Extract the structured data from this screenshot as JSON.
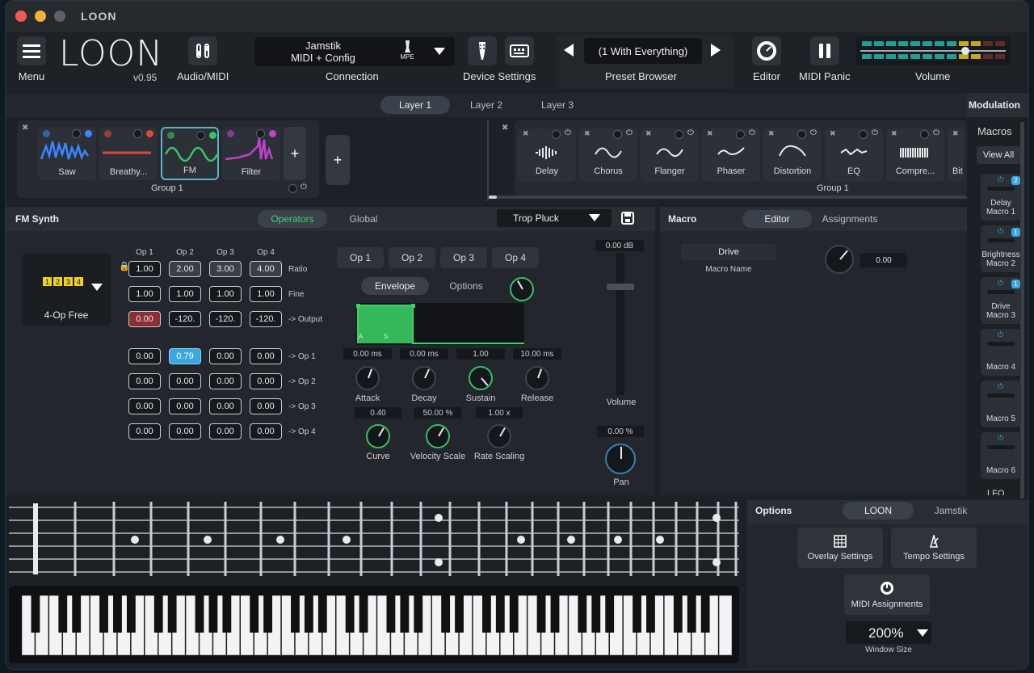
{
  "app": {
    "title": "LOON",
    "logo": "LOON",
    "version": "v0.95"
  },
  "toolbar": {
    "menu_label": "Menu",
    "audio_midi_label": "Audio/MIDI",
    "connection": {
      "line1": "Jamstik",
      "line2": "MIDI + Config",
      "badge": "MPE",
      "label": "Connection"
    },
    "device_settings_label": "Device Settings",
    "preset": {
      "name": "(1 With Everything)",
      "label": "Preset Browser"
    },
    "editor_label": "Editor",
    "midi_panic_label": "MIDI Panic",
    "volume_label": "Volume"
  },
  "layers": {
    "tabs": [
      "Layer 1",
      "Layer 2",
      "Layer 3"
    ],
    "active": 0
  },
  "instrument_group": {
    "name": "Group 1",
    "tiles": [
      {
        "name": "Saw",
        "color": "#3a86ff"
      },
      {
        "name": "Breathy...",
        "color": "#e0463a"
      },
      {
        "name": "FM",
        "color": "#39c46a"
      },
      {
        "name": "Filter",
        "color": "#c040d0"
      }
    ],
    "add_label": "+"
  },
  "add_group_label": "+",
  "fx_group": {
    "name": "Group 1",
    "items": [
      "Delay",
      "Chorus",
      "Flanger",
      "Phaser",
      "Distortion",
      "EQ",
      "Compre...",
      "Bit"
    ]
  },
  "fm_synth": {
    "title": "FM Synth",
    "tabs": [
      "Operators",
      "Global"
    ],
    "preset": "Trop Pluck",
    "algorithm": {
      "label": "4-Op Free",
      "ops": [
        "1",
        "2",
        "3",
        "4"
      ]
    },
    "columns": [
      "Op 1",
      "Op 2",
      "Op 3",
      "Op 4"
    ],
    "rows": [
      {
        "label": "Ratio",
        "values": [
          "1.00",
          "2.00",
          "3.00",
          "4.00"
        ]
      },
      {
        "label": "Fine",
        "values": [
          "1.00",
          "1.00",
          "1.00",
          "1.00"
        ]
      },
      {
        "label": "-> Output",
        "values": [
          "0.00",
          "-120.",
          "-120.",
          "-120."
        ]
      }
    ],
    "matrix": [
      {
        "label": "-> Op 1",
        "values": [
          "0.00",
          "0.79",
          "0.00",
          "0.00"
        ]
      },
      {
        "label": "-> Op 2",
        "values": [
          "0.00",
          "0.00",
          "0.00",
          "0.00"
        ]
      },
      {
        "label": "-> Op 3",
        "values": [
          "0.00",
          "0.00",
          "0.00",
          "0.00"
        ]
      },
      {
        "label": "-> Op 4",
        "values": [
          "0.00",
          "0.00",
          "0.00",
          "0.00"
        ]
      }
    ],
    "op_tabs": [
      "Op 1",
      "Op 2",
      "Op 3",
      "Op 4"
    ],
    "sub_tabs": [
      "Envelope",
      "Options"
    ],
    "env_values": [
      "0.00 ms",
      "0.00 ms",
      "1.00",
      "10.00 ms"
    ],
    "env_knobs": [
      "Attack",
      "Decay",
      "Sustain",
      "Release"
    ],
    "env_points": [
      "A",
      "S"
    ],
    "extra_values": [
      "0.40",
      "50.00 %",
      "1.00 x"
    ],
    "extra_knobs": [
      "Curve",
      "Velocity Scale",
      "Rate Scaling"
    ],
    "volume_db": "0.00 dB",
    "volume_label": "Volume",
    "pan_value": "0.00 %",
    "pan_label": "Pan"
  },
  "macro": {
    "title": "Macro",
    "tabs": [
      "Editor",
      "Assignments"
    ],
    "name_value": "Drive",
    "name_label": "Macro Name",
    "value": "0.00"
  },
  "modulation": {
    "title": "Modulation",
    "macros_label": "Macros",
    "view_all": "View All",
    "slots": [
      {
        "line1": "Delay",
        "line2": "Macro 1",
        "badge": "2"
      },
      {
        "line1": "Brightness",
        "line2": "Macro 2",
        "badge": "1"
      },
      {
        "line1": "Drive",
        "line2": "Macro 3",
        "badge": "1"
      },
      {
        "line1": "",
        "line2": "Macro 4",
        "badge": ""
      },
      {
        "line1": "",
        "line2": "Macro 5",
        "badge": ""
      },
      {
        "line1": "",
        "line2": "Macro 6",
        "badge": ""
      }
    ],
    "next_label": "LFO"
  },
  "options": {
    "title": "Options",
    "tabs": [
      "LOON",
      "Jamstik"
    ],
    "buttons": [
      "Overlay Settings",
      "Tempo Settings",
      "MIDI Assignments"
    ],
    "window_size": "200%",
    "window_size_label": "Window Size"
  },
  "colors": {
    "accent": "#38c160",
    "active_blue": "#3aa7e0"
  }
}
